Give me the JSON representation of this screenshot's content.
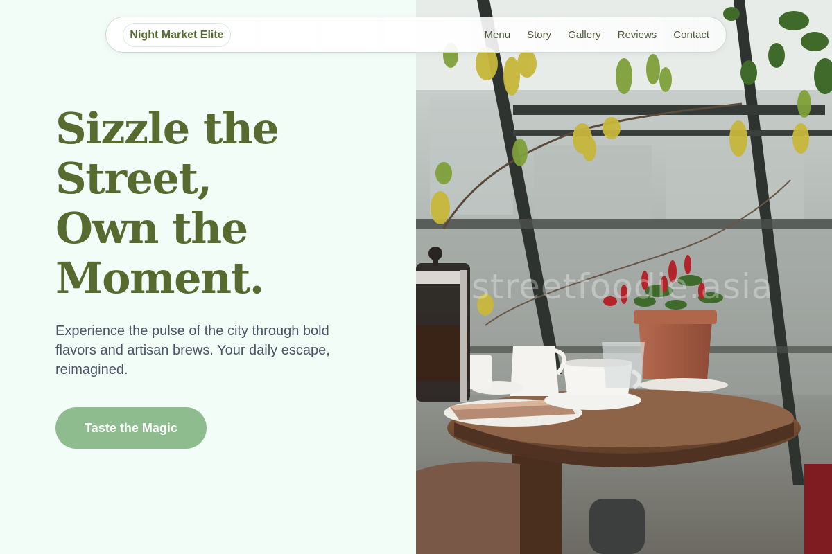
{
  "nav": {
    "brand": "Night Market Elite",
    "links": [
      "Menu",
      "Story",
      "Gallery",
      "Reviews",
      "Contact"
    ]
  },
  "hero": {
    "title_lines": [
      "Sizzle the",
      "Street,",
      "Own the",
      "Moment."
    ],
    "subtitle": "Experience the pulse of the city through bold flavors and artisan brews. Your daily escape, reimagined.",
    "cta_label": "Taste the Magic"
  },
  "image": {
    "watermark": "streetfoodie.asia"
  },
  "colors": {
    "background": "#f2fdf7",
    "title": "#556b2f",
    "cta": "#8fbc8f",
    "body_text": "#4a5568"
  }
}
